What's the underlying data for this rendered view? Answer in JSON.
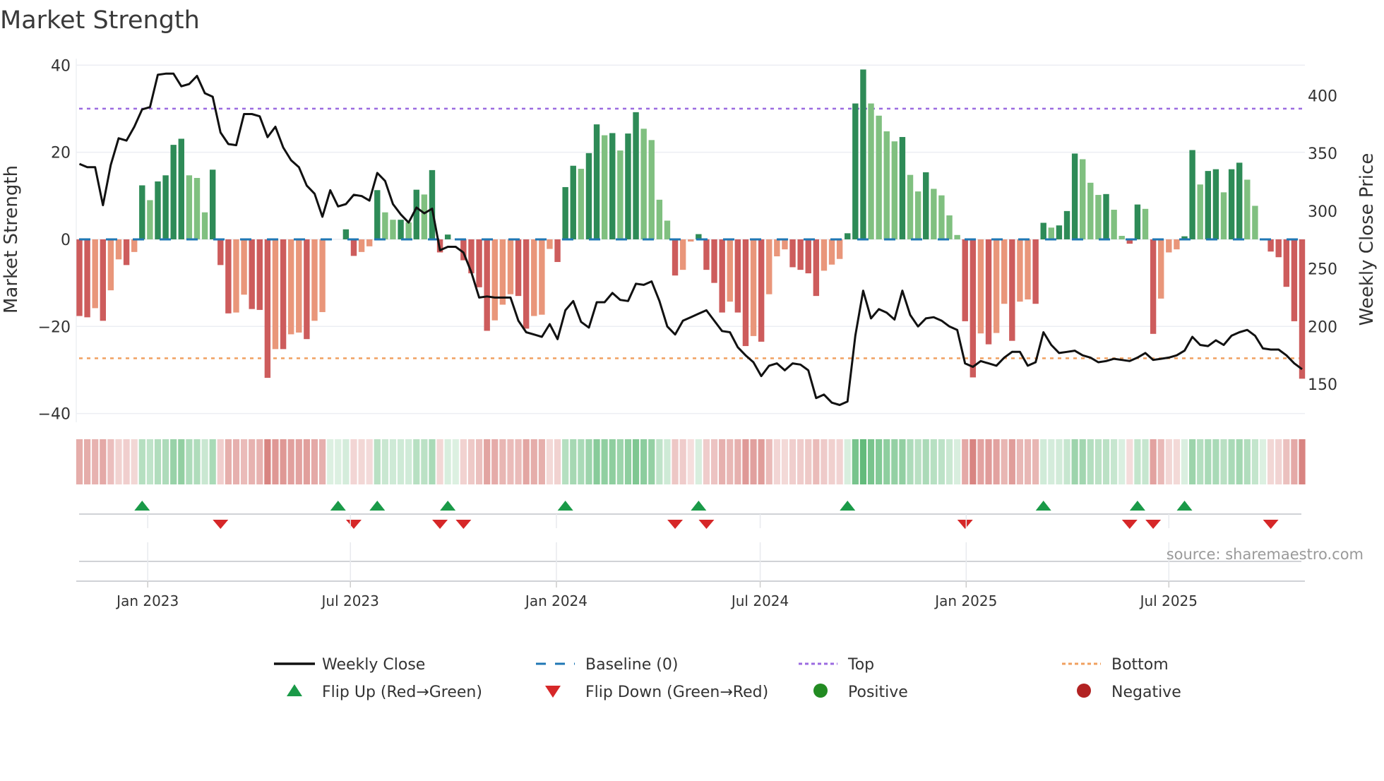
{
  "chart_data": {
    "type": "bar",
    "title": "Market Strength",
    "ylabel": "Market Strength",
    "y2label": "Weekly Close Price",
    "ylim": [
      -42,
      41.5
    ],
    "y2lim": [
      117,
      432
    ],
    "yticks": [
      40,
      20,
      0,
      -20,
      -40
    ],
    "ytick_labels": [
      "40",
      "20",
      "0",
      "−20",
      "−40"
    ],
    "y2ticks": [
      400,
      350,
      300,
      250,
      200,
      150
    ],
    "y2tick_labels": [
      "400",
      "350",
      "300",
      "250",
      "200",
      "150"
    ],
    "x_start_date": "2022-11-01",
    "x_step_days": 7,
    "xticks": [
      {
        "date": "2023-01-01",
        "label": "Jan 2023"
      },
      {
        "date": "2023-07-01",
        "label": "Jul 2023"
      },
      {
        "date": "2024-01-01",
        "label": "Jan 2024"
      },
      {
        "date": "2024-07-01",
        "label": "Jul 2024"
      },
      {
        "date": "2025-01-01",
        "label": "Jan 2025"
      },
      {
        "date": "2025-07-01",
        "label": "Jul 2025"
      }
    ],
    "top_level": 30,
    "bottom_level": -27.3,
    "baseline": 0,
    "strength": [
      -17.6,
      -17.9,
      -15.8,
      -18.7,
      -11.7,
      -4.6,
      -5.9,
      -2.9,
      12.4,
      9.0,
      13.3,
      14.7,
      21.7,
      23.1,
      14.7,
      14.1,
      6.2,
      16.0,
      -5.9,
      -17,
      -16.8,
      -12.7,
      -16,
      -16.2,
      -31.8,
      -25.2,
      -25.2,
      -21.8,
      -21.4,
      -22.9,
      -18.7,
      -16.7,
      0,
      0,
      2.3,
      -3.8,
      -2.9,
      -1.6,
      11.3,
      6.2,
      4.5,
      4.5,
      3.9,
      11.4,
      10.3,
      15.9,
      -3,
      1.1,
      0,
      -4.8,
      -7.8,
      -11,
      -21,
      -18.6,
      -15,
      -12.6,
      -13,
      -20.5,
      -17.6,
      -17.3,
      -2.2,
      -5.2,
      12,
      16.9,
      16.2,
      19.8,
      26.4,
      23.9,
      24.4,
      20.4,
      24.3,
      29.2,
      25.4,
      22.8,
      9.1,
      4.3,
      -8.3,
      -7,
      -0.5,
      1.2,
      -7,
      -10,
      -16.8,
      -14.3,
      -16.8,
      -24.5,
      -22.2,
      -23.5,
      -12.6,
      -3.9,
      -2.3,
      -6.4,
      -7,
      -7.8,
      -13,
      -7.2,
      -5.8,
      -4.5,
      1.4,
      31.2,
      39,
      31.2,
      28.4,
      24.8,
      22.5,
      23.5,
      14.8,
      11,
      15.4,
      11.6,
      10.1,
      5.5,
      1.0,
      -18.8,
      -31.7,
      -21.6,
      -24.1,
      -21.5,
      -14.8,
      -23.3,
      -14.3,
      -13.8,
      -14.8,
      3.8,
      2.7,
      3.2,
      6.5,
      19.7,
      18.4,
      13,
      10.2,
      10.4,
      6.8,
      0.8,
      -1,
      8,
      7,
      -21.7,
      -13.6,
      -3,
      -2.3,
      0.7,
      20.5,
      12.6,
      15.7,
      16.1,
      10.8,
      16.1,
      17.6,
      13.7,
      7.7,
      0,
      -2.8,
      -4.1,
      -10.9,
      -18.8,
      -32
    ],
    "weekly_close": [
      340.8,
      338,
      338,
      305,
      340,
      363,
      361,
      373,
      388,
      390,
      418,
      419,
      419,
      408,
      410,
      417,
      402,
      399,
      368,
      358,
      357,
      384,
      384,
      382,
      364,
      373,
      355,
      344,
      338,
      322,
      315,
      295,
      318,
      304,
      306,
      314,
      313,
      309,
      333,
      326,
      306,
      297,
      290,
      303,
      298,
      302,
      266,
      269,
      269,
      264,
      247,
      225,
      226,
      225,
      225,
      225,
      205,
      195,
      193,
      191,
      202,
      189,
      214,
      222,
      204,
      199,
      221,
      221,
      229,
      223,
      222,
      237,
      236,
      239,
      222,
      200,
      193,
      205,
      208,
      211,
      214,
      205,
      196,
      195,
      182,
      175,
      169,
      157,
      166,
      168,
      162,
      168,
      167,
      162,
      138,
      141,
      134,
      132,
      135,
      192,
      231,
      207,
      215,
      212,
      206,
      231,
      210,
      200,
      207,
      208,
      205,
      200,
      197,
      168,
      165,
      170,
      168,
      166,
      173,
      178,
      178,
      166,
      169,
      195,
      184,
      177,
      178,
      179,
      175,
      173,
      169,
      170,
      172,
      171,
      170,
      173,
      177,
      171,
      172,
      173,
      175,
      179,
      191,
      184,
      183,
      188,
      184,
      192,
      195,
      197,
      192,
      181,
      180,
      180,
      175,
      168,
      163
    ],
    "flip_up_weeks": [
      8,
      33,
      38,
      47,
      62,
      79,
      98,
      123,
      135,
      141
    ],
    "flip_down_weeks": [
      18,
      35,
      46,
      49,
      76,
      80,
      113,
      134,
      137,
      152
    ],
    "colors": {
      "pos_rising": "#2e8b57",
      "pos_falling": "#80c080",
      "neg_falling": "#cd5c5c",
      "neg_rising": "#e9967a",
      "line": "#111111",
      "baseline": "#1f77b4",
      "top": "#9b6be0",
      "bottom": "#f0a060",
      "flip_up": "#1a9a48",
      "flip_down": "#d62728",
      "positive": "#228b22",
      "negative": "#b22222"
    },
    "legend": [
      {
        "label": "Weekly Close",
        "symbol": "line"
      },
      {
        "label": "Baseline (0)",
        "symbol": "dashed"
      },
      {
        "label": "Top",
        "symbol": "dotted-top"
      },
      {
        "label": "Bottom",
        "symbol": "dotted-bottom"
      },
      {
        "label": "Flip Up (Red→Green)",
        "symbol": "triangle-up"
      },
      {
        "label": "Flip Down (Green→Red)",
        "symbol": "triangle-down"
      },
      {
        "label": "Positive",
        "symbol": "circle-positive"
      },
      {
        "label": "Negative",
        "symbol": "circle-negative"
      }
    ],
    "source": "source: sharemaestro.com"
  }
}
